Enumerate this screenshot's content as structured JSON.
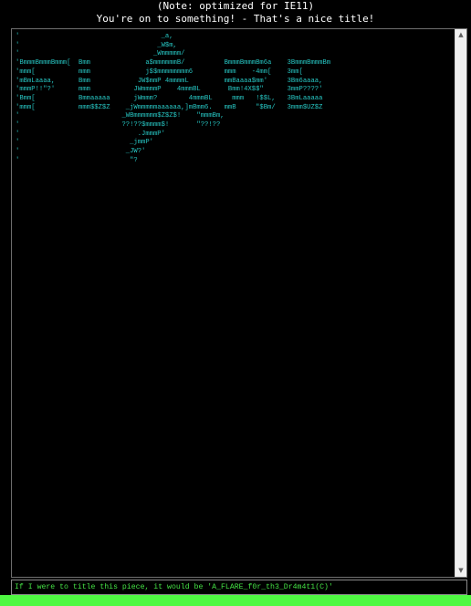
{
  "header": {
    "note": "(Note: optimized for IE11)",
    "message": "You're on to something! - That's a nice title!"
  },
  "art": {
    "lines": [
      "'                                    _a,",
      "'                                   _W$m,",
      "'                                  _Wmmmmm/",
      "'BmmmBmmmBmmm[  Bmm              a$mmmmmmB/          BmmmBmmmBm6a    3BmmmBmmmBm",
      "'mmm[           mmm              j$$mmmmmmmm6        mmm    -4mm[    3mm[",
      "'mBmLaaaa,      Bmm            JW$mmP 4mmmmL         mmBaaaa$mm'     3Bm6aaaa,",
      "'mmmP!!\"?'      mmm           JWmmmmP    4mmmBL       Bmm!4X$$\"      3mmP????'",
      "'Bmm[           Bmmaaaaa      jWmmm?        4mmmBL     mmm   !$$L,   3BmLaaaaa",
      "'mmm[           mmm$$Z$Z    _jWmmmmmaaaaaa,]mBmm6.   mmB     \"$Bm/   3mmm$UZ$Z",
      "'                          _WBmmmmmm$Z$Z$!    \"mmmBm,",
      "'                          ??!??$mmmm$!       \"??!??",
      "'                              .JmmmP'",
      "'                            _jmmP'",
      "'                           _JW?'",
      "'                            \"?"
    ]
  },
  "input": {
    "value": "If I were to title this piece, it would be 'A_FLARE_f0r_th3_Dr4m4t1(C)'"
  },
  "scrollbar": {
    "up_icon": "▲",
    "down_icon": "▼"
  },
  "colors": {
    "background": "#000000",
    "header_text": "#ffffff",
    "art_text": "#27c7c4",
    "input_text": "#45e245",
    "green_bar": "#4ff842"
  }
}
